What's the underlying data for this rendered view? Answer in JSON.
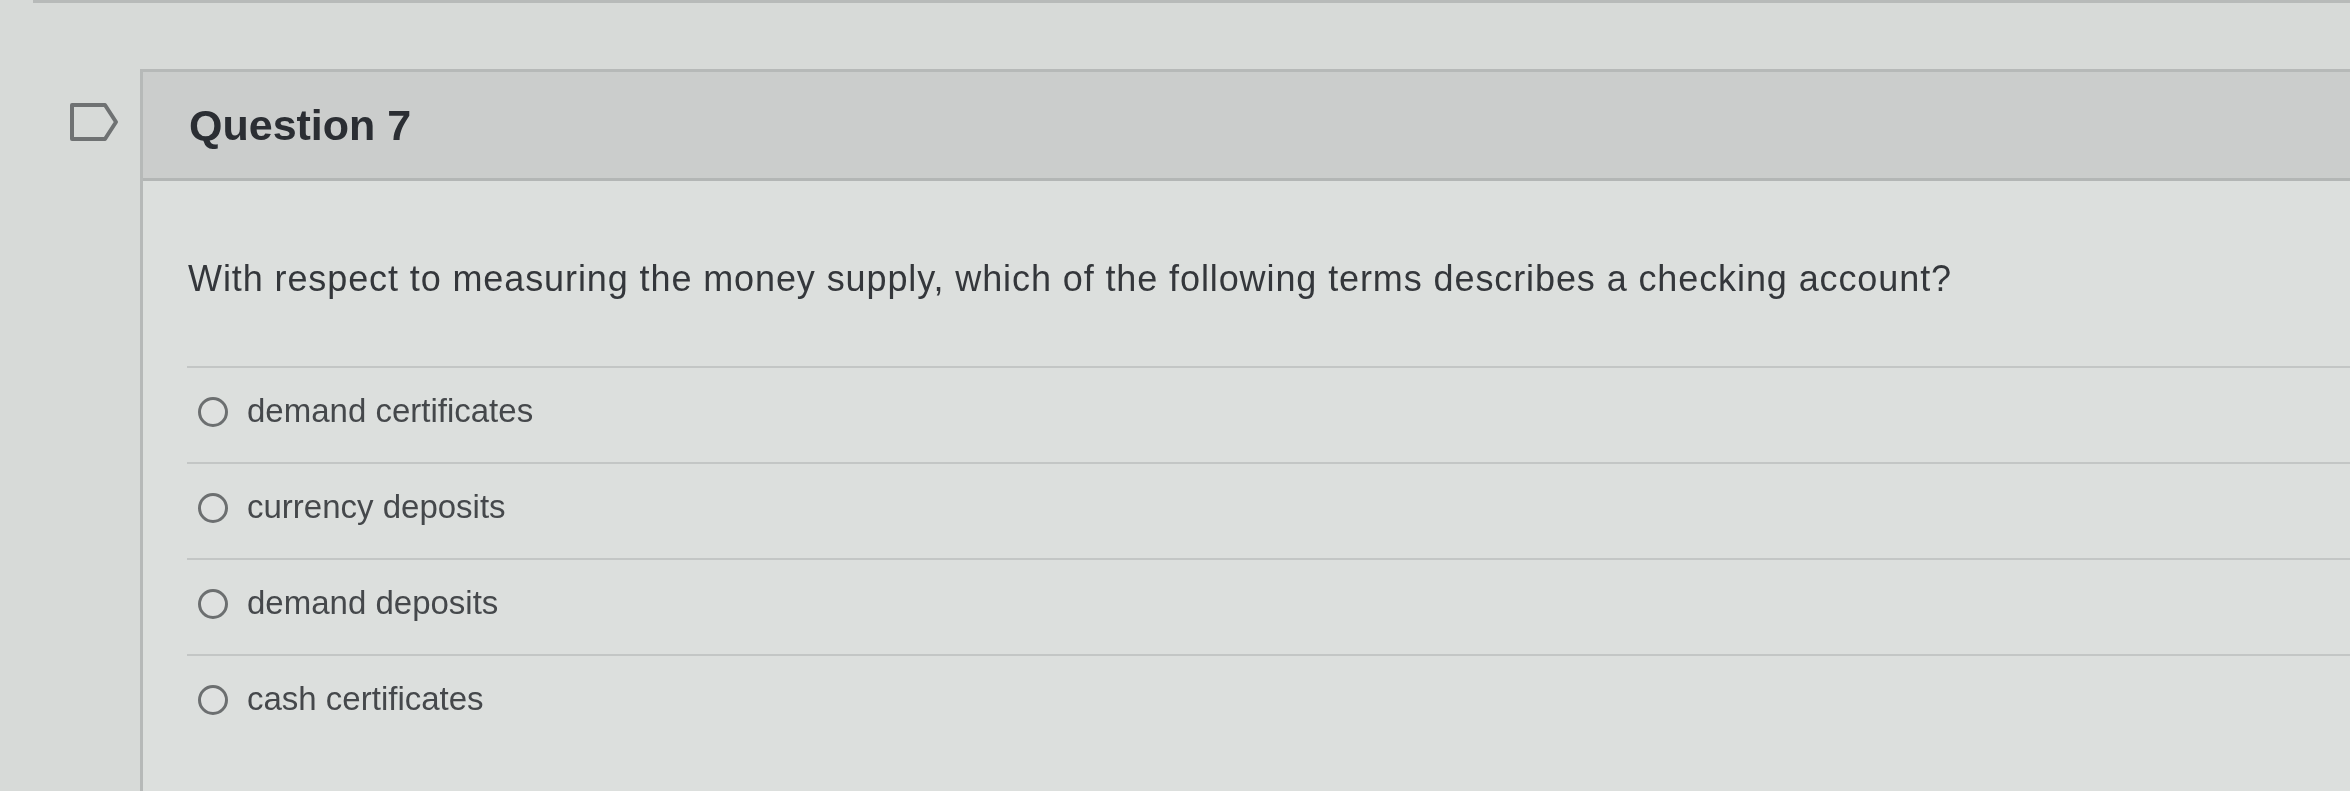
{
  "question": {
    "title": "Question 7",
    "flagged": false,
    "text": "With respect to measuring the money supply, which of the following terms describes a checking account?"
  },
  "options": [
    {
      "label": "demand certificates",
      "selected": false
    },
    {
      "label": "currency deposits",
      "selected": false
    },
    {
      "label": "demand deposits",
      "selected": false
    },
    {
      "label": "cash certificates",
      "selected": false
    }
  ]
}
